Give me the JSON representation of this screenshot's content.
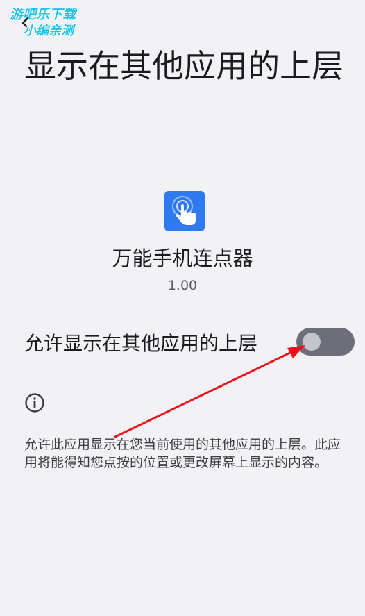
{
  "watermark": {
    "line1": "游吧乐下载",
    "line2": "小编亲测"
  },
  "header": {
    "back_icon": "back-arrow-icon",
    "title": "显示在其他应用的上层"
  },
  "app": {
    "icon": "tap-hand-icon",
    "icon_color": "#2f7af0",
    "name": "万能手机连点器",
    "version": "1.00"
  },
  "permission": {
    "label": "允许显示在其他应用的上层",
    "enabled": false
  },
  "info": {
    "icon": "info-icon",
    "description": "允许此应用显示在您当前使用的其他应用的上层。此应用将能得知您点按的位置或更改屏幕上显示的内容。"
  },
  "annotation": {
    "color": "#e8141c"
  }
}
